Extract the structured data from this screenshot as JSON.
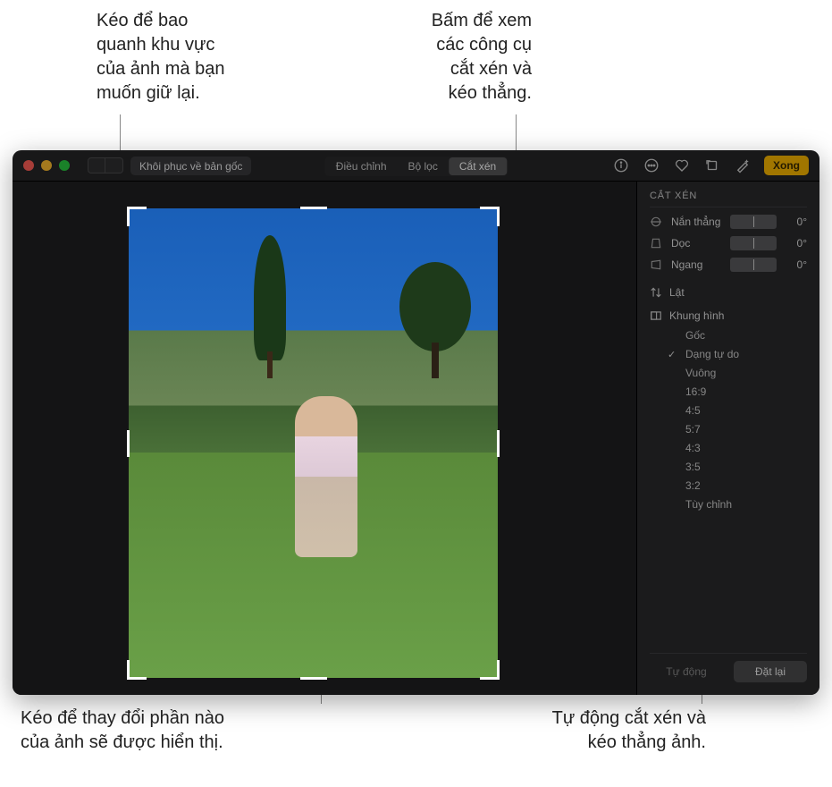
{
  "callouts": {
    "top_left": "Kéo để bao\nquanh khu vực\ncủa ảnh mà bạn\nmuốn giữ lại.",
    "top_right": "Bấm để xem\ncác công cụ\ncắt xén và\nkéo thẳng.",
    "bottom_left": "Kéo để thay đổi phần nào\ncủa ảnh sẽ được hiển thị.",
    "bottom_right": "Tự động cắt xén và\nkéo thẳng ảnh."
  },
  "toolbar": {
    "revert_label": "Khôi phục về bản gốc",
    "tabs": {
      "adjust": "Điều chỉnh",
      "filters": "Bộ lọc",
      "crop": "Cắt xén"
    },
    "done_label": "Xong"
  },
  "sidebar": {
    "title": "CẮT XÉN",
    "sliders": {
      "straighten": {
        "label": "Nắn thẳng",
        "value": "0°"
      },
      "vertical": {
        "label": "Dọc",
        "value": "0°"
      },
      "horizontal": {
        "label": "Ngang",
        "value": "0°"
      }
    },
    "flip_label": "Lật",
    "aspect_header": "Khung hình",
    "aspects": {
      "original": "Gốc",
      "freeform": "Dạng tự do",
      "square": "Vuông",
      "r169": "16:9",
      "r45": "4:5",
      "r57": "5:7",
      "r43": "4:3",
      "r35": "3:5",
      "r32": "3:2",
      "custom": "Tùy chỉnh"
    },
    "auto_label": "Tự động",
    "reset_label": "Đặt lại"
  }
}
